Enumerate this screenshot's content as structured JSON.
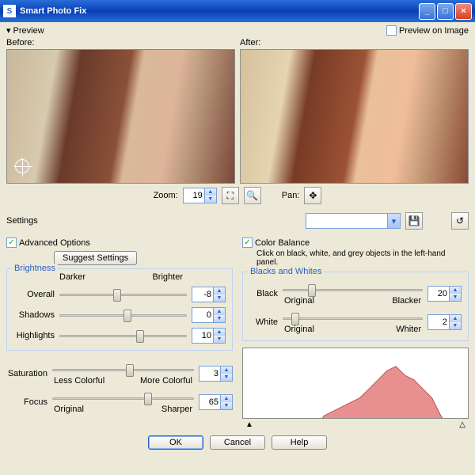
{
  "window": {
    "title": "Smart Photo Fix"
  },
  "preview": {
    "label": "Preview",
    "onImage": "Preview on Image",
    "before": "Before:",
    "after": "After:"
  },
  "zoom": {
    "label": "Zoom:",
    "value": "19",
    "panLabel": "Pan:"
  },
  "settings": {
    "label": "Settings"
  },
  "adv": {
    "label": "Advanced Options",
    "suggest": "Suggest Settings"
  },
  "brightness": {
    "legend": "Brightness",
    "leftHint": "Darker",
    "rightHint": "Brighter",
    "overall": {
      "label": "Overall",
      "value": "-8",
      "pos": 42
    },
    "shadows": {
      "label": "Shadows",
      "value": "0",
      "pos": 50
    },
    "highlights": {
      "label": "Highlights",
      "value": "10",
      "pos": 60
    }
  },
  "saturation": {
    "label": "Saturation",
    "left": "Less Colorful",
    "right": "More Colorful",
    "value": "3",
    "pos": 52
  },
  "focus": {
    "label": "Focus",
    "left": "Original",
    "right": "Sharper",
    "value": "65",
    "pos": 65
  },
  "colorBalance": {
    "label": "Color Balance",
    "hint": "Click on black, white, and grey objects in the left-hand panel."
  },
  "bw": {
    "legend": "Blacks and Whites",
    "black": {
      "label": "Black",
      "left": "Original",
      "right": "Blacker",
      "value": "20",
      "pos": 18
    },
    "white": {
      "label": "White",
      "left": "Original",
      "right": "Whiter",
      "value": "2",
      "pos": 6
    }
  },
  "buttons": {
    "ok": "OK",
    "cancel": "Cancel",
    "help": "Help"
  },
  "icons": {
    "fit": "⛶",
    "oneToOne": "🔍",
    "pan": "✥",
    "save": "💾",
    "reset": "↺"
  }
}
